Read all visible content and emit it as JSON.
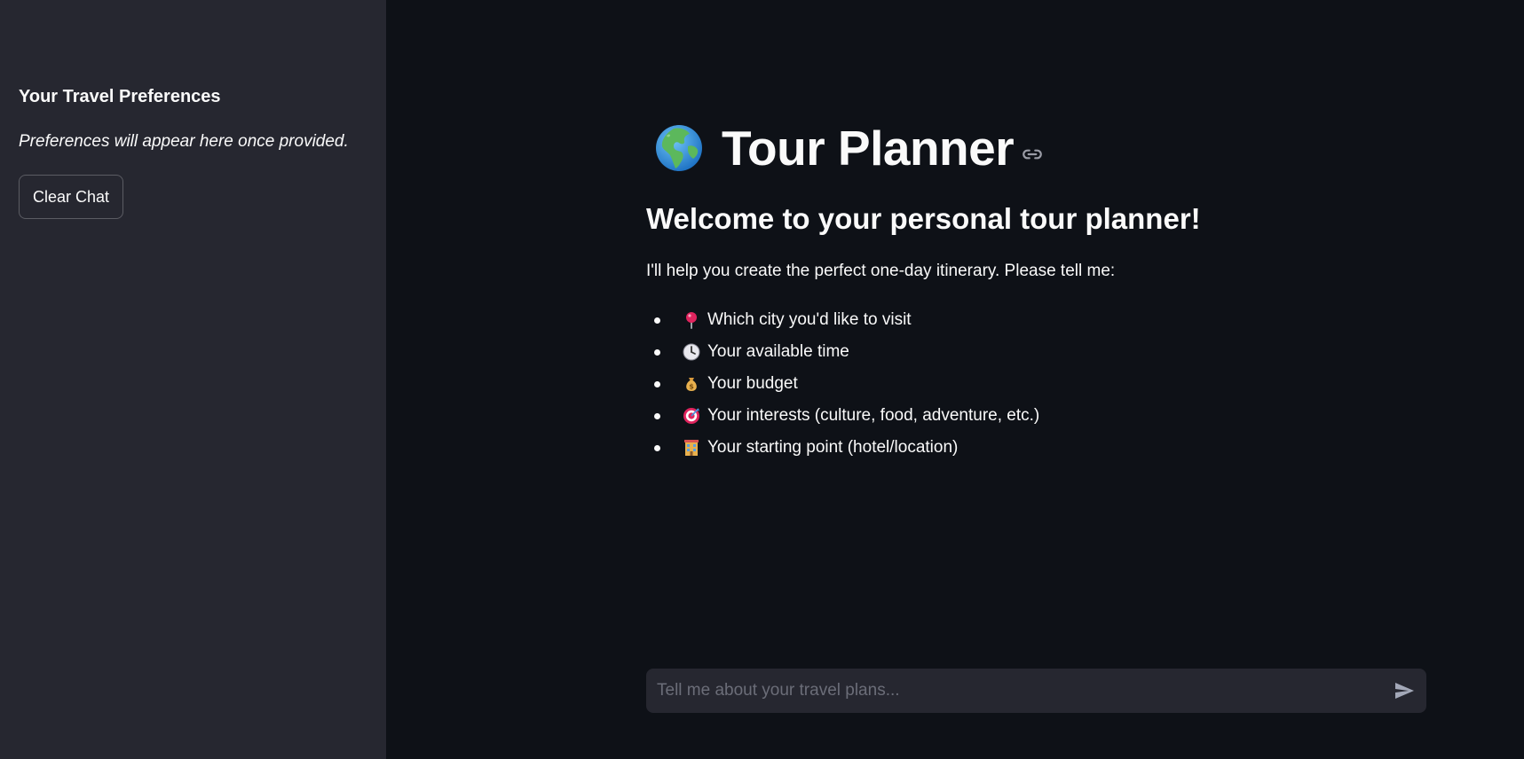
{
  "sidebar": {
    "header": "Your Travel Preferences",
    "note": "Preferences will appear here once provided.",
    "clear_button_label": "Clear Chat"
  },
  "main": {
    "title": "Tour Planner",
    "title_icon": "globe-europe-africa-icon",
    "anchor_icon": "link-icon",
    "welcome_heading": "Welcome to your personal tour planner!",
    "intro": "I'll help you create the perfect one-day itinerary. Please tell me:",
    "items": [
      {
        "icon": "round-pushpin-icon",
        "label": "Which city you'd like to visit"
      },
      {
        "icon": "clock-icon",
        "label": "Your available time"
      },
      {
        "icon": "money-bag-icon",
        "label": "Your budget"
      },
      {
        "icon": "direct-hit-icon",
        "label": "Your interests (culture, food, adventure, etc.)"
      },
      {
        "icon": "hotel-icon",
        "label": "Your starting point (hotel/location)"
      }
    ]
  },
  "chat": {
    "placeholder": "Tell me about your travel plans...",
    "value": "",
    "send_icon": "send-icon"
  },
  "colors": {
    "main_background": "#0e1117",
    "sidebar_background": "#262730",
    "text": "#fafafa",
    "input_background": "#262730"
  }
}
